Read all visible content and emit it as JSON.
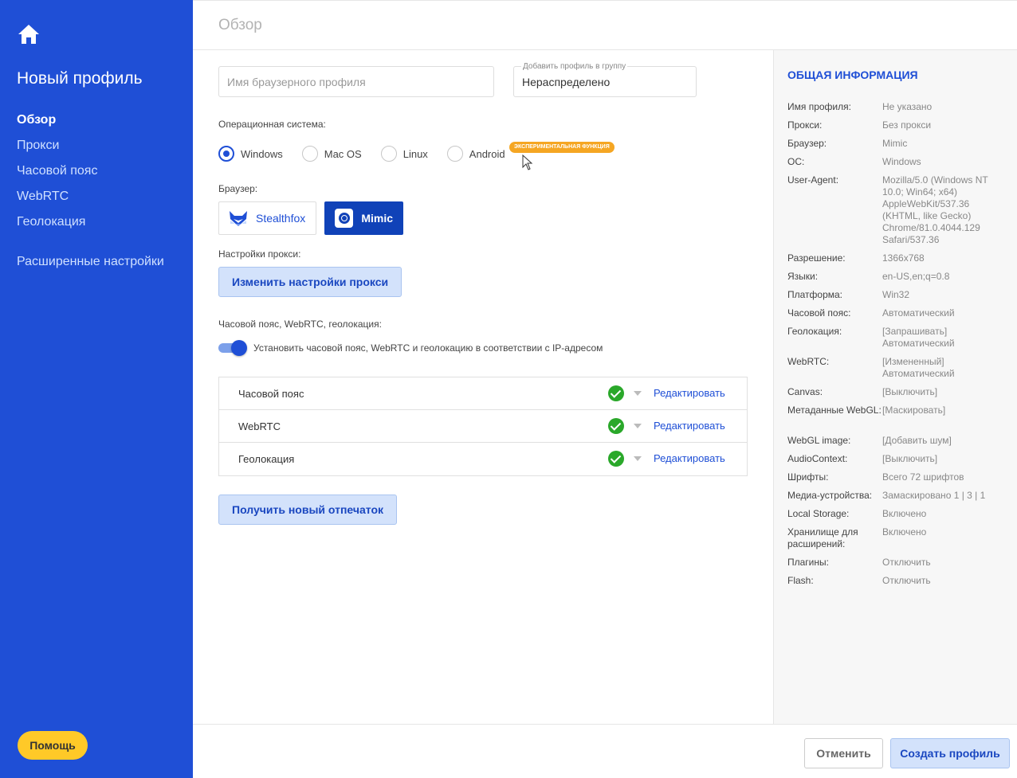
{
  "sidebar": {
    "title": "Новый профиль",
    "nav": [
      "Обзор",
      "Прокси",
      "Часовой пояс",
      "WebRTC",
      "Геолокация"
    ],
    "advanced": "Расширенные настройки",
    "help": "Помощь",
    "accent_color": "#1f4fd6"
  },
  "header": {
    "title": "Обзор"
  },
  "form": {
    "name_placeholder": "Имя браузерного профиля",
    "name_value": "",
    "group_label": "Добавить профиль в группу",
    "group_value": "Нераспределено",
    "os_label": "Операционная система:",
    "os_options": [
      "Windows",
      "Mac OS",
      "Linux",
      "Android"
    ],
    "os_selected": "Windows",
    "experimental_badge": "ЭКСПЕРИМЕНТАЛЬНАЯ ФУНКЦИЯ",
    "browser_label": "Браузер:",
    "browsers": [
      "Stealthfox",
      "Mimic"
    ],
    "browser_selected": "Mimic",
    "proxy_label": "Настройки прокси:",
    "proxy_button": "Изменить настройки прокси",
    "tz_section_label": "Часовой пояс, WebRTC, геолокация:",
    "toggle_text": "Установить часовой пояс, WebRTC и геолокацию в соответствии с IP-адресом",
    "toggle_on": true,
    "settings_rows": [
      {
        "label": "Часовой пояс",
        "action": "Редактировать"
      },
      {
        "label": "WebRTC",
        "action": "Редактировать"
      },
      {
        "label": "Геолокация",
        "action": "Редактировать"
      }
    ],
    "fingerprint_button": "Получить новый отпечаток"
  },
  "info": {
    "title": "ОБЩАЯ ИНФОРМАЦИЯ",
    "rows": [
      {
        "key": "Имя профиля:",
        "value": "Не указано"
      },
      {
        "key": "Прокси:",
        "value": "Без прокси"
      },
      {
        "key": "Браузер:",
        "value": "Mimic"
      },
      {
        "key": "ОС:",
        "value": "Windows"
      },
      {
        "key": "User-Agent:",
        "value": "Mozilla/5.0 (Windows NT 10.0; Win64; x64) AppleWebKit/537.36 (KHTML, like Gecko) Chrome/81.0.4044.129 Safari/537.36"
      },
      {
        "key": "Разрешение:",
        "value": "1366x768"
      },
      {
        "key": "Языки:",
        "value": "en-US,en;q=0.8"
      },
      {
        "key": "Платформа:",
        "value": "Win32"
      },
      {
        "key": "Часовой пояс:",
        "value": "Автоматический"
      },
      {
        "key": "Геолокация:",
        "value": "[Запрашивать] Автоматический"
      },
      {
        "key": "WebRTC:",
        "value": "[Измененный] Автоматический"
      },
      {
        "key": "Canvas:",
        "value": "[Выключить]"
      },
      {
        "key": "Метаданные WebGL:",
        "value": "[Маскировать]"
      },
      {
        "key": "WebGL image:",
        "value": "[Добавить шум]"
      },
      {
        "key": "AudioContext:",
        "value": "[Выключить]"
      },
      {
        "key": "Шрифты:",
        "value": "Всего 72 шрифтов"
      },
      {
        "key": "Медиа-устройства:",
        "value": "Замаскировано 1 | 3 | 1"
      },
      {
        "key": "Local Storage:",
        "value": "Включено"
      },
      {
        "key": "Хранилище для расширений:",
        "value": "Включено"
      },
      {
        "key": "Плагины:",
        "value": "Отключить"
      },
      {
        "key": "Flash:",
        "value": "Отключить"
      }
    ]
  },
  "footer": {
    "cancel": "Отменить",
    "create": "Создать профиль"
  }
}
